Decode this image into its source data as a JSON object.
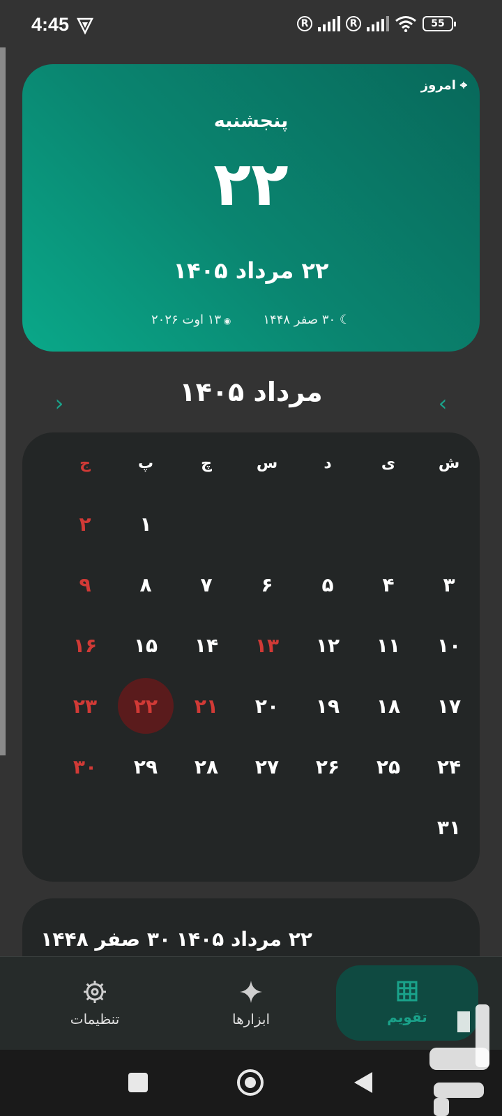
{
  "status_bar": {
    "time": "4:45",
    "battery": "55"
  },
  "today_card": {
    "today_label": "امروز",
    "weekday": "پنجشنبه",
    "day_number": "۲۲",
    "full_date": "۲۲ مرداد ۱۴۰۵",
    "hijri_date": "۳۰ صفر ۱۴۴۸",
    "gregorian_date": "۱۳ اوت ۲۰۲۶"
  },
  "month_header": {
    "title": "مرداد ۱۴۰۵",
    "prev_arrow": "‹",
    "next_arrow": "›"
  },
  "calendar": {
    "weekdays": [
      "ش",
      "ی",
      "د",
      "س",
      "چ",
      "پ",
      "ج"
    ],
    "weeks": [
      [
        "",
        "",
        "",
        "",
        "",
        "۱",
        "۲"
      ],
      [
        "۳",
        "۴",
        "۵",
        "۶",
        "۷",
        "۸",
        "۹"
      ],
      [
        "۱۰",
        "۱۱",
        "۱۲",
        "۱۳",
        "۱۴",
        "۱۵",
        "۱۶"
      ],
      [
        "۱۷",
        "۱۸",
        "۱۹",
        "۲۰",
        "۲۱",
        "۲۲",
        "۲۳"
      ],
      [
        "۲۴",
        "۲۵",
        "۲۶",
        "۲۷",
        "۲۸",
        "۲۹",
        "۳۰"
      ],
      [
        "۳۱",
        "",
        "",
        "",
        "",
        "",
        ""
      ]
    ],
    "holidays": [
      "۱۳",
      "۲۱"
    ],
    "today": "۲۲",
    "holiday_color": "#d13a36",
    "today_bg": "#5a1b1c"
  },
  "info_card": {
    "shamsi": "۲۲ مرداد ۱۴۰۵",
    "hijri": "۳۰ صفر ۱۴۴۸"
  },
  "bottom_nav": {
    "calendar_label": "تقویم",
    "tools_label": "ابزارها",
    "settings_label": "تنظیمات",
    "accent": "#1aa28a"
  }
}
